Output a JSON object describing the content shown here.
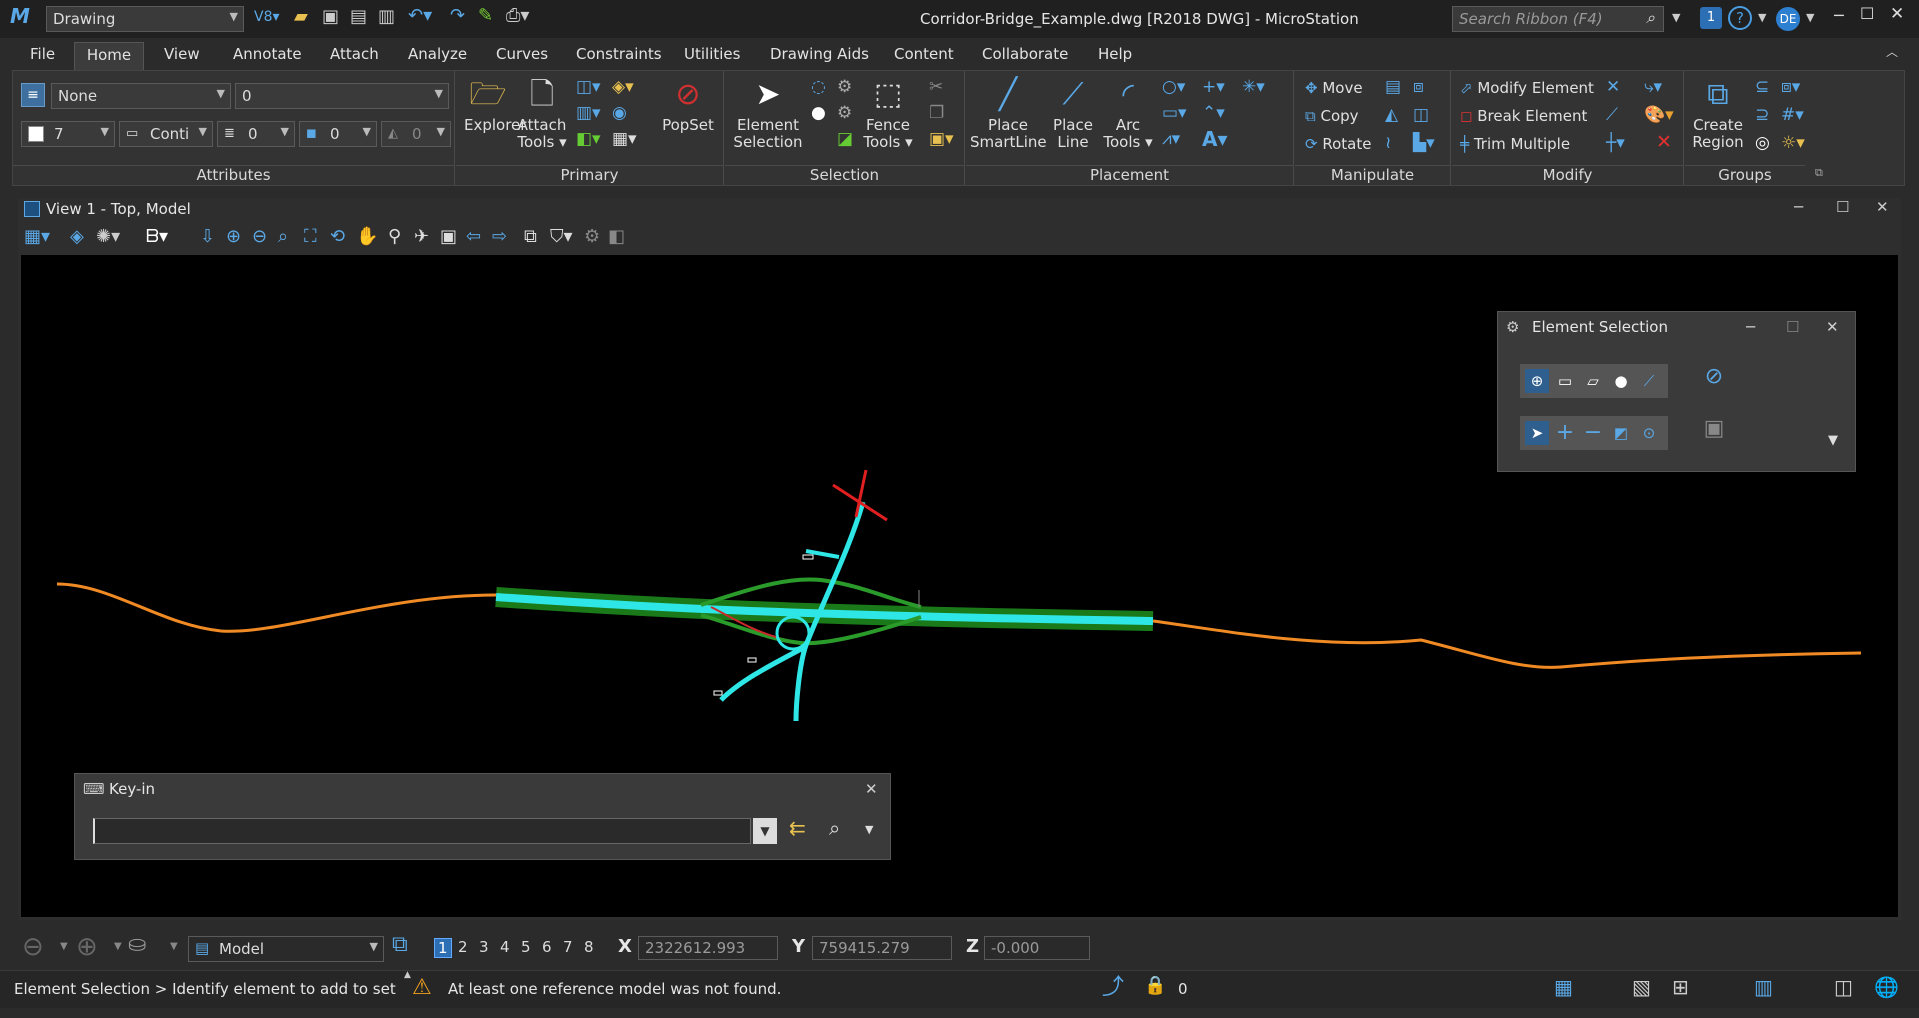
{
  "titlebar": {
    "workflow": "Drawing",
    "title": "Corridor-Bridge_Example.dwg [R2018 DWG] - MicroStation",
    "search_placeholder": "Search Ribbon (F4)",
    "user_initials": "DE",
    "notif_count": "1"
  },
  "menu": [
    "File",
    "Home",
    "View",
    "Annotate",
    "Attach",
    "Analyze",
    "Curves",
    "Constraints",
    "Utilities",
    "Drawing Aids",
    "Content",
    "Collaborate",
    "Help"
  ],
  "ribbon": {
    "attributes": {
      "level": "None",
      "level2": "0",
      "color": "7",
      "linestyle": "Conti",
      "weight": "0",
      "transparency": "0",
      "priority": "0",
      "label": "Attributes"
    },
    "primary": {
      "explorer": "Explorer",
      "attach": "Attach",
      "attach2": "Tools",
      "popset": "PopSet",
      "label": "Primary"
    },
    "selection": {
      "element": "Element",
      "element2": "Selection",
      "fence": "Fence",
      "fence2": "Tools",
      "label": "Selection"
    },
    "placement": {
      "smart": "Place",
      "smart2": "SmartLine",
      "line": "Place",
      "line2": "Line",
      "arc": "Arc",
      "arc2": "Tools",
      "label": "Placement"
    },
    "manipulate": {
      "move": "Move",
      "copy": "Copy",
      "rotate": "Rotate",
      "label": "Manipulate"
    },
    "modify": {
      "modify": "Modify Element",
      "break": "Break Element",
      "trim": "Trim Multiple",
      "label": "Modify"
    },
    "groups": {
      "region": "Create",
      "region2": "Region",
      "label": "Groups"
    }
  },
  "view": {
    "title": "View 1 - Top, Model"
  },
  "element_selection": {
    "title": "Element Selection"
  },
  "keyin": {
    "title": "Key-in",
    "value": ""
  },
  "statusbar": {
    "model": "Model",
    "pages": [
      "1",
      "2",
      "3",
      "4",
      "5",
      "6",
      "7",
      "8"
    ],
    "x_label": "X",
    "x": "2322612.993",
    "y_label": "Y",
    "y": "759415.279",
    "z_label": "Z",
    "z": "-0.000",
    "prompt": "Element Selection > Identify element to add to set",
    "message": "At least one reference model was not found.",
    "lock_count": "0"
  }
}
